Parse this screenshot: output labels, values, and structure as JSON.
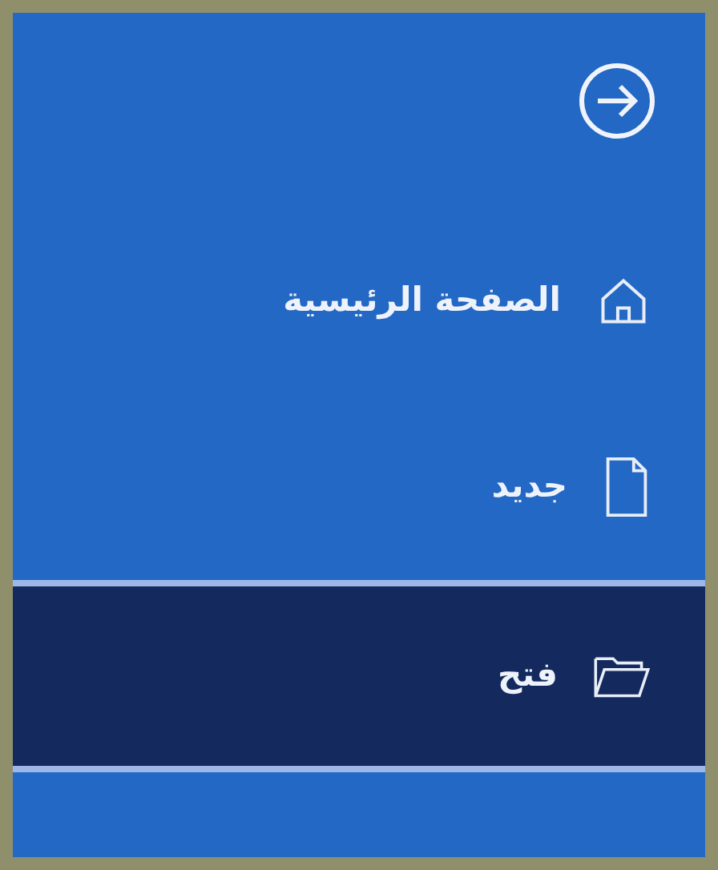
{
  "sidebar": {
    "items": [
      {
        "label": "الصفحة الرئيسية",
        "kind": "home",
        "selected": false
      },
      {
        "label": "جديد",
        "kind": "new",
        "selected": false
      },
      {
        "label": "فتح",
        "kind": "open",
        "selected": true
      }
    ]
  }
}
